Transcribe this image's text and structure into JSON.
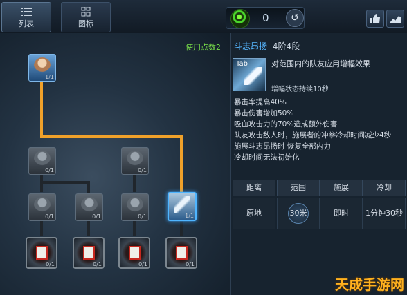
{
  "tabs": [
    {
      "label": "列表",
      "icon": "list-icon"
    },
    {
      "label": "图标",
      "icon": "grid-icon"
    }
  ],
  "points": {
    "value": "0",
    "icon": "green-gem-icon",
    "reset_icon": "reset-icon"
  },
  "tree": {
    "used_points_label": "使用点数2",
    "root_level": "1/1",
    "nodes": [
      "0/1",
      "0/1",
      "0/1",
      "0/1",
      "0/1",
      "0/1",
      "1/1"
    ],
    "locked": [
      "0/1",
      "0/1",
      "0/1",
      "0/1"
    ]
  },
  "skill": {
    "name": "斗志昂扬",
    "rank": "4阶4段",
    "key": "Tab",
    "description": "对范围内的队友应用增幅效果",
    "duration": "增幅状态持续10秒",
    "effects": [
      "暴击率提高40%",
      "暴击伤害增加50%",
      "吸血攻击力的70%造成额外伤害",
      "队友攻击敌人时，施展者的冲拳冷却时间减少4秒",
      "施展斗志昂扬时 恢复全部内力",
      "冷却时间无法初始化"
    ],
    "stats_headers": [
      "距离",
      "范围",
      "施展",
      "冷却"
    ],
    "stats_values": [
      "原地",
      "30米",
      "即时",
      "1分钟30秒"
    ]
  },
  "watermark": "天成手游网",
  "colors": {
    "accent": "#56b6ff",
    "line": "#f0a12a",
    "points": "#79e04a"
  }
}
